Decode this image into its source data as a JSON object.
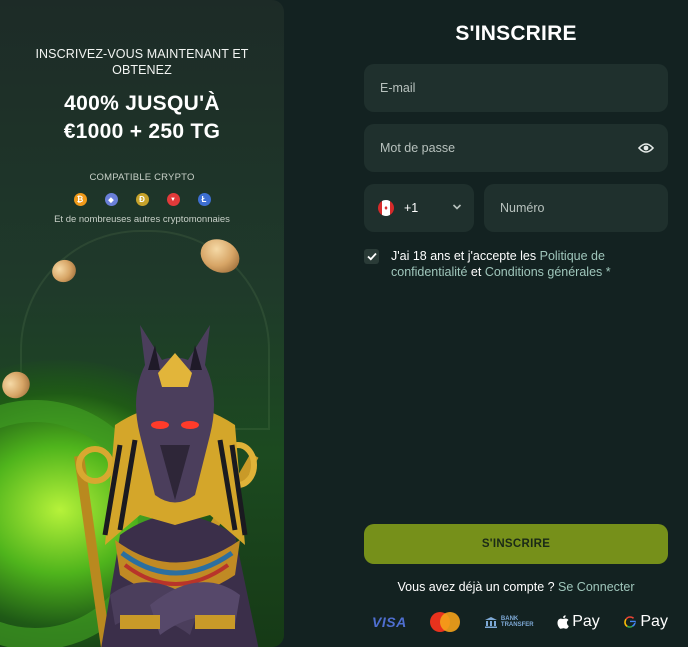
{
  "promo": {
    "subtitle": "INSCRIVEZ-VOUS MAINTENANT ET OBTENEZ",
    "headline_line1": "400% JUSQU'À",
    "headline_line2": "€1000 + 250 TG",
    "crypto_label": "COMPATIBLE CRYPTO",
    "crypto_icons": [
      {
        "name": "bitcoin-icon",
        "glyph": "₿",
        "color": "#f09a1a"
      },
      {
        "name": "ethereum-icon",
        "glyph": "◆",
        "color": "#6a7fd8"
      },
      {
        "name": "dogecoin-icon",
        "glyph": "Ð",
        "color": "#c6a22a"
      },
      {
        "name": "tron-icon",
        "glyph": "▼",
        "color": "#e23a3a"
      },
      {
        "name": "litecoin-icon",
        "glyph": "Ł",
        "color": "#3d6fd1"
      }
    ],
    "more_text": "Et de nombreuses autres cryptomonnaies"
  },
  "form": {
    "title": "S'INSCRIRE",
    "email_placeholder": "E-mail",
    "password_placeholder": "Mot de passe",
    "country_code": "+1",
    "phone_placeholder": "Numéro",
    "terms": {
      "text_before": "J'ai 18 ans et j'accepte les ",
      "privacy_link": "Politique de confidentialité",
      "and": " et ",
      "conditions_link": "Conditions générales",
      "required_mark": " *"
    },
    "submit_label": "S'INSCRIRE",
    "login_prompt": "Vous avez déjà un compte ? ",
    "login_link": "Se Connecter"
  },
  "payments": {
    "visa": "VISA",
    "bank_line1": "BANK",
    "bank_line2": "TRANSFER",
    "apple_pay": "Pay",
    "google_pay": "Pay"
  },
  "colors": {
    "accent_button": "#76901a",
    "link": "#9fc6bb",
    "field_bg": "#1f302d",
    "page_bg": "#132221"
  }
}
